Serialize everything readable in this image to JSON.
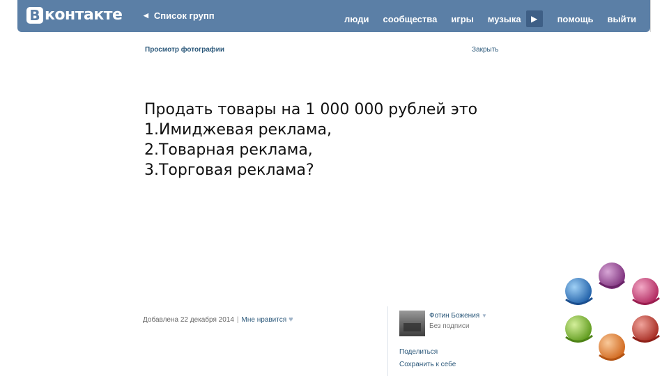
{
  "header": {
    "logo_letter": "В",
    "logo_text": "контакте",
    "back_label": "Список групп",
    "nav": {
      "people": "люди",
      "communities": "сообщества",
      "games": "игры",
      "music": "музыка",
      "help": "помощь",
      "logout": "выйти"
    },
    "play_icon": "▶"
  },
  "viewer": {
    "title": "Просмотр фотографии",
    "close": "Закрыть"
  },
  "slide": {
    "lines": [
      "Продать товары на 1 000 000 рублей это",
      "1.Имиджевая реклама,",
      "2.Товарная реклама,",
      "3.Торговая реклама?"
    ]
  },
  "meta": {
    "added": "Добавлена 22 декабря 2014",
    "separator": "|",
    "like": "Мне нравится"
  },
  "sidebar": {
    "author": "Фотин Божения",
    "author_sub": "Без подписи",
    "share": "Поделиться",
    "save": "Сохранить к себе"
  },
  "colors": {
    "header_bg": "#5b7fa6",
    "link": "#2b587a",
    "deco": [
      "#3a7fc1",
      "#8e3a8c",
      "#c0356f",
      "#c0392b",
      "#e07b2a",
      "#7ab32e"
    ]
  }
}
